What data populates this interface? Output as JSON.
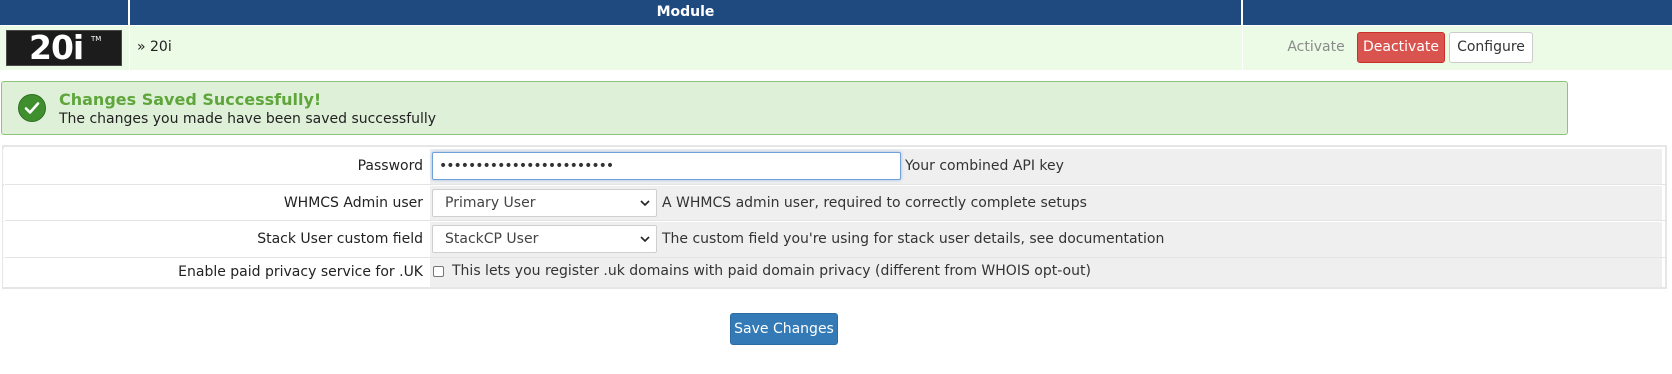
{
  "header": {
    "title": "Module"
  },
  "module": {
    "logo_text": "20i",
    "logo_tm": "TM",
    "name": "» 20i",
    "actions": {
      "activate": "Activate",
      "deactivate": "Deactivate",
      "configure": "Configure"
    }
  },
  "alert": {
    "title": "Changes Saved Successfully!",
    "message": "The changes you made have been saved successfully",
    "icon": "check-circle-icon",
    "color": "#dff0d8"
  },
  "settings": {
    "password": {
      "label": "Password",
      "value": "••••••••••••••••••••••••",
      "help": "Your combined API key"
    },
    "admin_user": {
      "label": "WHMCS Admin user",
      "selected": "Primary User",
      "help": "A WHMCS admin user, required to correctly complete setups"
    },
    "stack_user_field": {
      "label": "Stack User custom field",
      "selected": "StackCP User",
      "help": "The custom field you're using for stack user details, see documentation"
    },
    "uk_privacy": {
      "label": "Enable paid privacy service for .UK",
      "checked": false,
      "help": "This lets you register .uk domains with paid domain privacy (different from WHOIS opt-out)"
    }
  },
  "save_label": "Save Changes",
  "colors": {
    "header": "#1f4a80",
    "deactivate": "#d9534f",
    "save": "#337ab7",
    "success_title": "#5ea63c"
  }
}
